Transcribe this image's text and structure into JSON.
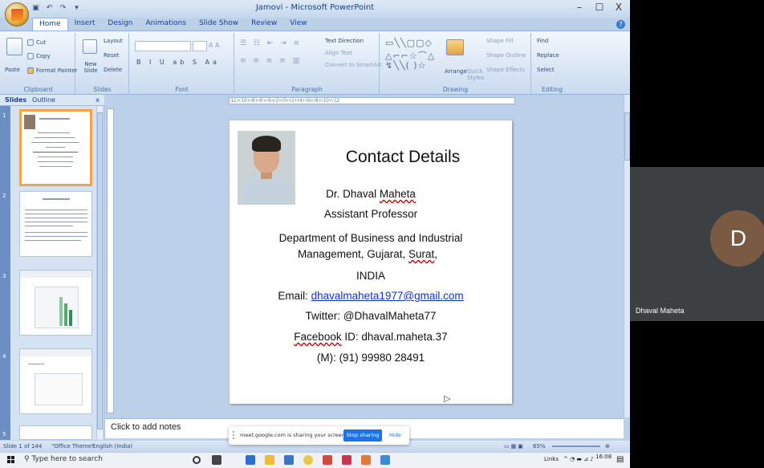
{
  "window": {
    "title": "Jamovi - Microsoft PowerPoint",
    "minimize": "–",
    "maximize": "☐",
    "close": "X"
  },
  "ribbon_tabs": [
    "Home",
    "Insert",
    "Design",
    "Animations",
    "Slide Show",
    "Review",
    "View"
  ],
  "ribbon": {
    "clipboard": {
      "paste": "Paste",
      "cut": "Cut",
      "copy": "Copy",
      "format_painter": "Format Painter",
      "label": "Clipboard"
    },
    "slides": {
      "new_slide": "New Slide",
      "layout": "Layout",
      "reset": "Reset",
      "delete": "Delete",
      "label": "Slides"
    },
    "font": {
      "label": "Font"
    },
    "paragraph": {
      "text_direction": "Text Direction",
      "align_text": "Align Text",
      "smartart": "Convert to SmartArt",
      "label": "Paragraph"
    },
    "drawing": {
      "arrange": "Arrange",
      "quick_styles": "Quick Styles",
      "shape_fill": "Shape Fill",
      "shape_outline": "Shape Outline",
      "shape_effects": "Shape Effects",
      "label": "Drawing"
    },
    "editing": {
      "find": "Find",
      "replace": "Replace",
      "select": "Select",
      "label": "Editing"
    }
  },
  "left_panel": {
    "tab_slides": "Slides",
    "tab_outline": "Outline",
    "close": "x",
    "thumbnails": [
      {
        "number": "1"
      },
      {
        "number": "2"
      },
      {
        "number": "3"
      },
      {
        "number": "4"
      },
      {
        "number": "5"
      }
    ]
  },
  "ruler_text": "·12·ı·ı·10·ı·ı·8·ı·ı·6·ı·ı·4·ı·ı·2·ı·ı·0·ı·ı·2·ı·ı·4·ı·ı·6·ı·ı·8·ı·ı·10·ı·ı·12·",
  "slide": {
    "title": "Contact Details",
    "name_prefix": "Dr. Dhaval ",
    "name_surname": "Maheta",
    "designation": "Assistant Professor",
    "department_line1": "Department of Business and Industrial",
    "department_line2_a": "Management, Gujarat, ",
    "department_line2_b": "Surat",
    "department_line2_c": ",",
    "country": "INDIA",
    "email_label": "Email: ",
    "email": "dhavalmaheta1977@gmail.com",
    "twitter": "Twitter: @DhavalMaheta77",
    "facebook_label": "Facebook",
    "facebook_rest": " ID: dhaval.maheta.37",
    "mobile": "(M): (91) 99980 28491"
  },
  "notes_placeholder": "Click to add notes",
  "status_bar": {
    "slide_count": "Slide 1 of 144",
    "theme": "\"Office Theme\"",
    "language": "English (India)",
    "zoom": "65%"
  },
  "share_banner": {
    "message": "meet.google.com is sharing your screen.",
    "stop": "Stop sharing",
    "hide": "Hide"
  },
  "taskbar": {
    "search_placeholder": "Type here to search",
    "tray_links": "Links",
    "time": "16:08"
  },
  "meet": {
    "avatar_letter": "D",
    "participant_name": "Dhaval Maheta",
    "avatar_color": "#7b5a44"
  }
}
